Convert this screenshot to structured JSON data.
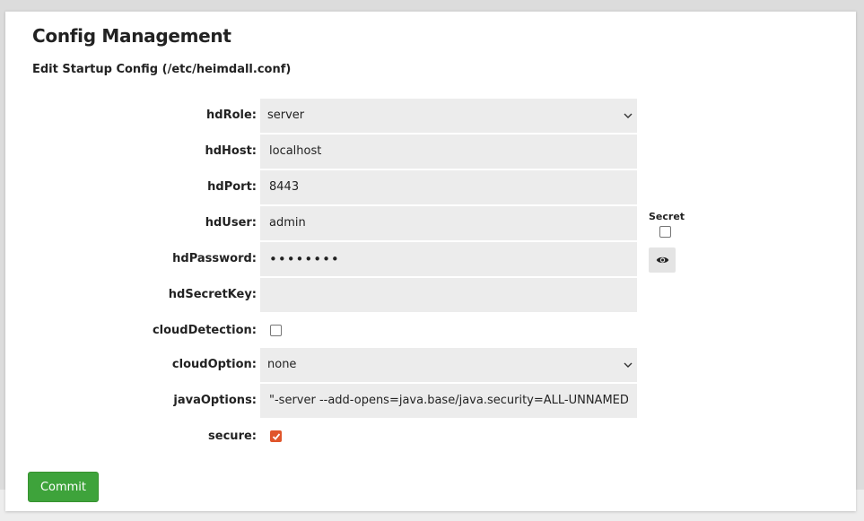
{
  "page": {
    "title": "Config Management",
    "subtitle": "Edit Startup Config (/etc/heimdall.conf)"
  },
  "form": {
    "hdRole": {
      "label": "hdRole:",
      "value": "server"
    },
    "hdHost": {
      "label": "hdHost:",
      "value": "localhost"
    },
    "hdPort": {
      "label": "hdPort:",
      "value": "8443"
    },
    "hdUser": {
      "label": "hdUser:",
      "value": "admin"
    },
    "hdPassword": {
      "label": "hdPassword:",
      "value": "••••••••"
    },
    "hdSecretKey": {
      "label": "hdSecretKey:",
      "value": ""
    },
    "cloudDetection": {
      "label": "cloudDetection:",
      "checked": false
    },
    "cloudOption": {
      "label": "cloudOption:",
      "value": "none"
    },
    "javaOptions": {
      "label": "javaOptions:",
      "value": "\"-server --add-opens=java.base/java.security=ALL-UNNAMED --add-opens"
    },
    "secure": {
      "label": "secure:",
      "checked": true
    },
    "secret": {
      "label": "Secret",
      "checked": false
    }
  },
  "actions": {
    "commit_label": "Commit"
  },
  "colors": {
    "accent": "#e0552b",
    "commit": "#3ea33b"
  },
  "icons": {
    "show_password": "eye-icon",
    "dropdown": "chevron-down-icon"
  }
}
